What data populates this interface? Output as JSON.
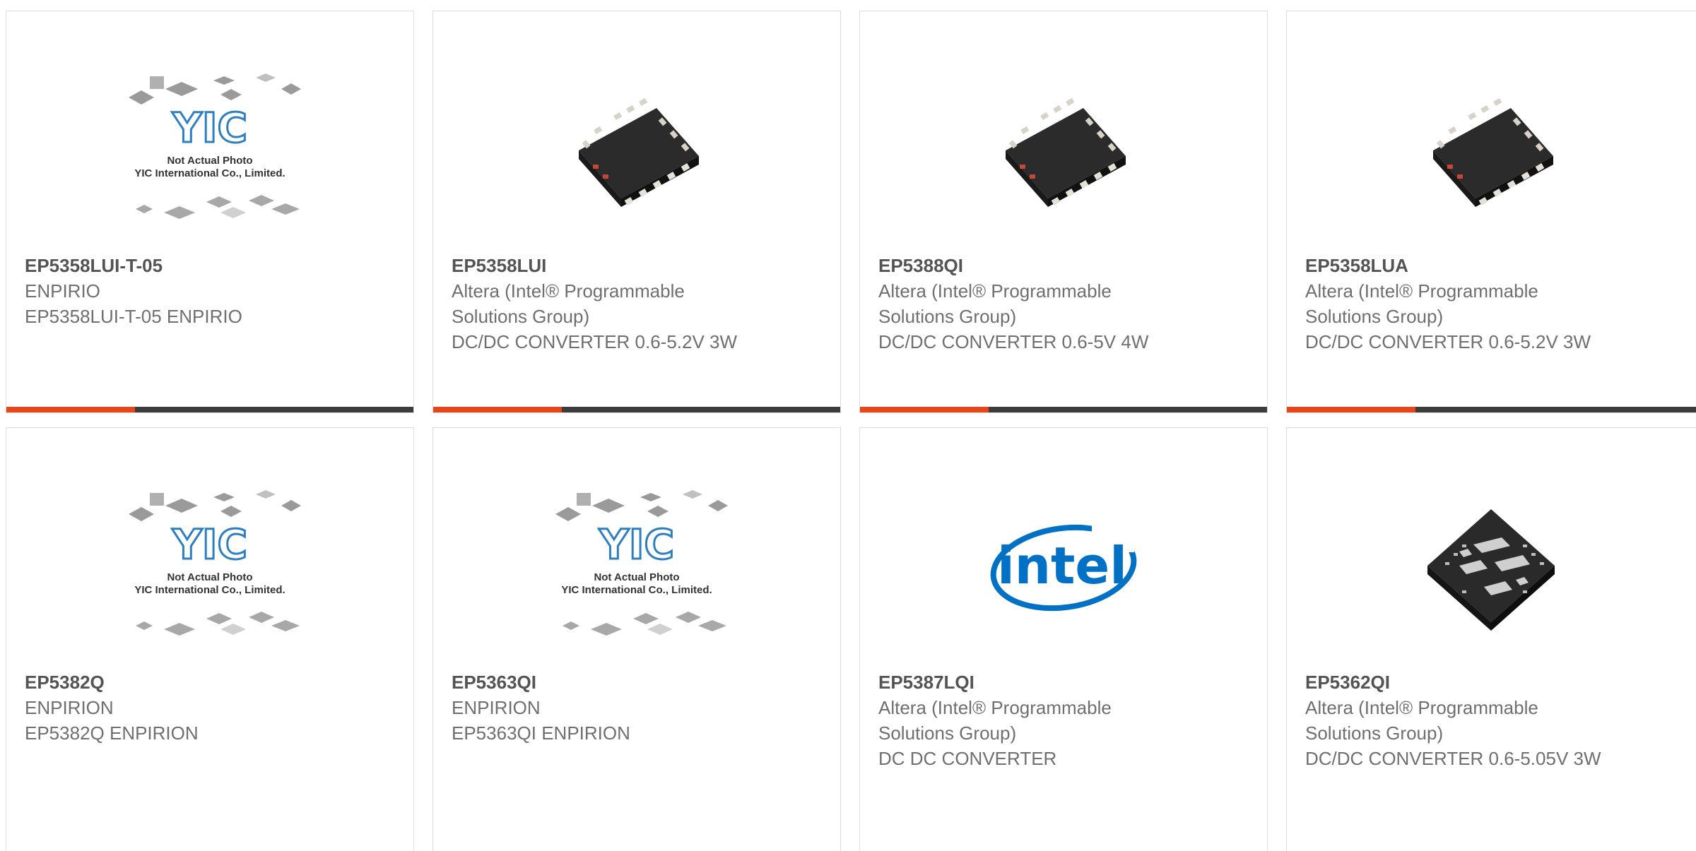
{
  "products": [
    {
      "part": "EP5358LUI-T-05",
      "lines": [
        "ENPIRIO",
        "EP5358LUI-T-05 ENPIRIO"
      ],
      "image": "placeholder"
    },
    {
      "part": "EP5358LUI",
      "lines": [
        "Altera (Intel® Programmable Solutions Group)",
        "DC/DC CONVERTER 0.6-5.2V 3W"
      ],
      "image": "qfn-chip"
    },
    {
      "part": "EP5388QI",
      "lines": [
        "Altera (Intel® Programmable Solutions Group)",
        "DC/DC CONVERTER 0.6-5V 4W"
      ],
      "image": "qfn-chip"
    },
    {
      "part": "EP5358LUA",
      "lines": [
        "Altera (Intel® Programmable Solutions Group)",
        "DC/DC CONVERTER 0.6-5.2V 3W"
      ],
      "image": "qfn-chip"
    },
    {
      "part": "EP5382Q",
      "lines": [
        "ENPIRION",
        "EP5382Q ENPIRION"
      ],
      "image": "placeholder"
    },
    {
      "part": "EP5363QI",
      "lines": [
        "ENPIRION",
        "EP5363QI ENPIRION"
      ],
      "image": "placeholder"
    },
    {
      "part": "EP5387LQI",
      "lines": [
        "Altera (Intel® Programmable Solutions Group)",
        "DC DC CONVERTER"
      ],
      "image": "intel-logo"
    },
    {
      "part": "EP5362QI",
      "lines": [
        "Altera (Intel® Programmable Solutions Group)",
        "DC/DC CONVERTER 0.6-5.05V 3W"
      ],
      "image": "module-chip"
    }
  ],
  "placeholder": {
    "logo": "YIC",
    "line1": "Not Actual Photo",
    "line2": "YIC International Co., Limited."
  },
  "intel_logo_text": "intel",
  "colors": {
    "accent": "#e8461a",
    "bar": "#3c3c3c",
    "text": "#6f6f6f",
    "border": "#dcdcdc",
    "intel_blue": "#0071c5",
    "yic_blue": "#2d7fc1"
  }
}
